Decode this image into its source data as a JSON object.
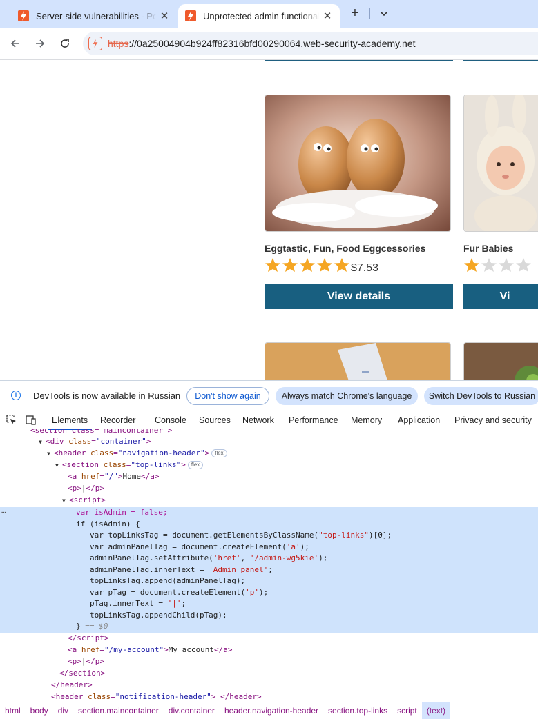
{
  "browser": {
    "tabs": [
      {
        "title": "Server-side vulnerabilities - Port",
        "active": false
      },
      {
        "title": "Unprotected admin functionality",
        "active": true
      }
    ],
    "url_scheme": "https",
    "url_rest": "://0a25004904b924ff82316bfd00290064.web-security-academy.net"
  },
  "products": [
    {
      "title": "Eggtastic, Fun, Food Eggcessories",
      "rating": 5,
      "price": "$7.53",
      "button": "View details"
    },
    {
      "title": "Fur Babies",
      "rating": 1,
      "price": "",
      "button": "Vi"
    }
  ],
  "devtools": {
    "info_message": "DevTools is now available in Russian",
    "buttons": {
      "dont_show": "Don't show again",
      "match_language": "Always match Chrome's language",
      "switch": "Switch DevTools to Russian"
    },
    "tabs": [
      "Elements",
      "Recorder",
      "Console",
      "Sources",
      "Network",
      "Performance",
      "Memory",
      "Application",
      "Privacy and security"
    ],
    "active_tab": "Elements",
    "code": {
      "l0": "<section class=\"maincontainer\">",
      "l1_tag": "div",
      "l1_attr": "class",
      "l1_val": "\"container\"",
      "l2_tag": "header",
      "l2_attr": "class",
      "l2_val": "\"navigation-header\"",
      "l2_badge": "flex",
      "l3_tag": "section",
      "l3_attr": "class",
      "l3_val": "\"top-links\"",
      "l3_badge": "flex",
      "l4_href": "\"/\"",
      "l4_text": "Home",
      "l5_text": "|",
      "l6_tag": "script",
      "js1": "var isAdmin = false;",
      "js2": "if (isAdmin) {",
      "js3a": "var topLinksTag = document.getElementsByClassName(",
      "js3b": "\"top-links\"",
      "js3c": ")[0];",
      "js4a": "var adminPanelTag = document.createElement(",
      "js4b": "'a'",
      "js4c": ");",
      "js5a": "adminPanelTag.setAttribute(",
      "js5b": "'href'",
      "js5c": ", ",
      "js5d": "'/admin-wg5kie'",
      "js5e": ");",
      "js6a": "adminPanelTag.innerText = ",
      "js6b": "'Admin panel'",
      "js6c": ";",
      "js7": "topLinksTag.append(adminPanelTag);",
      "js8a": "var pTag = document.createElement(",
      "js8b": "'p'",
      "js8c": ");",
      "js9a": "pTag.innerText = ",
      "js9b": "'|'",
      "js9c": ";",
      "js10": "topLinksTag.appendChild(pTag);",
      "js11": "}",
      "dollar": "== $0",
      "l_end_script": "script",
      "myacc_href": "\"/my-account\"",
      "myacc_text": "My account",
      "p2_text": "|",
      "end_section": "section",
      "end_header": "header",
      "notif_val": "\"notification-header\""
    },
    "breadcrumbs": [
      "html",
      "body",
      "div",
      "section.maincontainer",
      "div.container",
      "header.navigation-header",
      "section.top-links",
      "script",
      "(text)"
    ]
  },
  "colors": {
    "accent_button": "#185f80",
    "star_gold": "#f5a623",
    "star_grey": "#d9d9d9",
    "selection": "#cfe3fc"
  }
}
